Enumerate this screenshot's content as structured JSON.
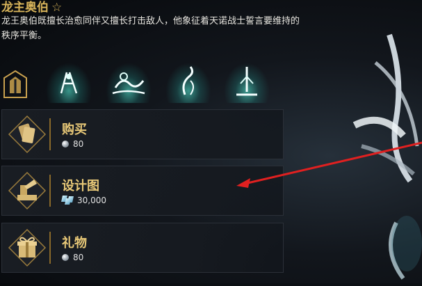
{
  "header": {
    "name": "龙主奥伯",
    "favorite_icon": "star-outline-icon",
    "description": "龙王奥伯既擅长治愈同伴又擅长打击敌人，他象征着天诺战士誓言要维持的秩序平衡。"
  },
  "skills": {
    "icons": [
      "faction-emblem-icon",
      "skill-1-icon",
      "skill-2-icon",
      "skill-3-icon",
      "skill-4-icon"
    ]
  },
  "store": {
    "items": [
      {
        "label": "购买",
        "price": "80",
        "currency_icon": "platinum-icon",
        "item_icon": "cards-icon"
      },
      {
        "label": "设计图",
        "price": "30,000",
        "currency_icon": "credits-icon",
        "item_icon": "blueprint-icon"
      },
      {
        "label": "礼物",
        "price": "80",
        "currency_icon": "platinum-icon",
        "item_icon": "gift-icon"
      }
    ]
  },
  "colors": {
    "accent_gold": "#e9c978",
    "skill_glow": "#5affe6",
    "arrow_red": "#e02020"
  }
}
